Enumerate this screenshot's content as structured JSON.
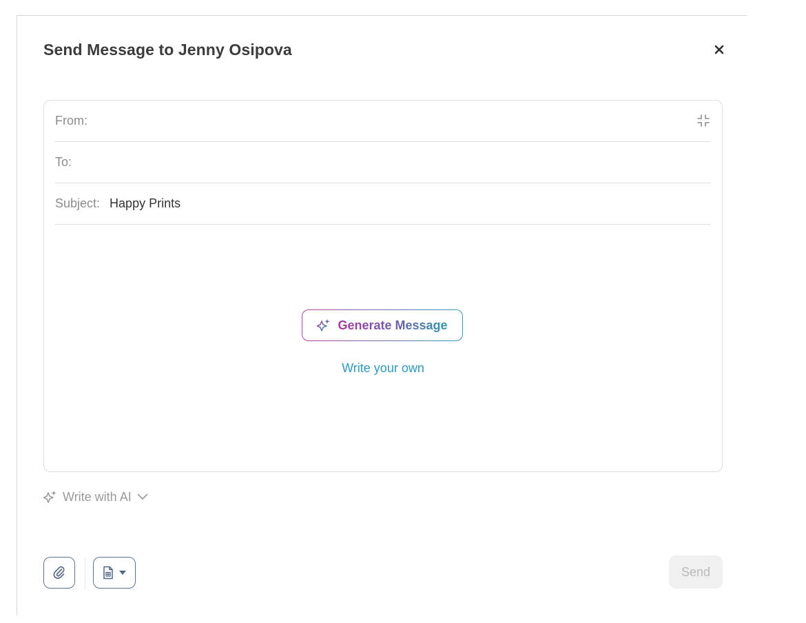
{
  "modal": {
    "title": "Send Message to Jenny Osipova",
    "close_icon": "close-icon"
  },
  "compose": {
    "from_label": "From:",
    "from_value": "",
    "to_label": "To:",
    "to_value": "",
    "subject_label": "Subject:",
    "subject_value": "Happy Prints",
    "collapse_icon": "collapse-icon",
    "generate_label": "Generate Message",
    "generate_icon": "sparkle-icon",
    "write_own_label": "Write your own"
  },
  "ai": {
    "label": "Write with AI",
    "icon": "sparkle-icon",
    "chevron_icon": "chevron-down-icon"
  },
  "toolbar": {
    "attach_icon": "paperclip-icon",
    "template_icon": "document-icon",
    "template_caret_icon": "caret-down-icon",
    "send_label": "Send"
  },
  "colors": {
    "gradient_start": "#b43e9c",
    "gradient_end": "#2d9cb0",
    "link": "#2b9ac4",
    "button_border": "#5e7290",
    "send_disabled_bg": "#f0f0f0"
  }
}
